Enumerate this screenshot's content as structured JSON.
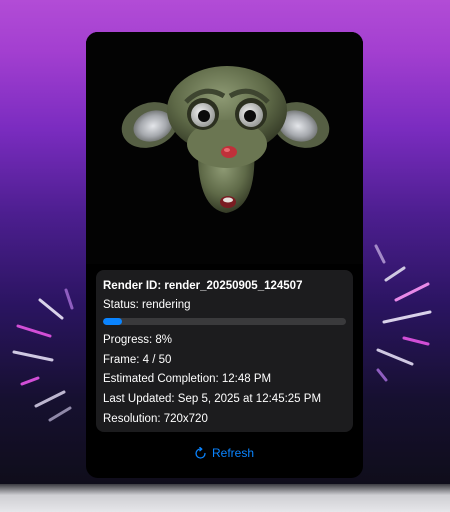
{
  "render": {
    "id_line": "Render ID: render_20250905_124507",
    "status_line": "Status: rendering",
    "progress_fraction": 0.08,
    "progress_line": "Progress: 8%",
    "frame_line": "Frame: 4 / 50",
    "eta_line": "Estimated Completion: 12:48 PM",
    "updated_line": "Last Updated: Sep 5, 2025 at 12:45:25 PM",
    "resolution_line": "Resolution: 720x720"
  },
  "actions": {
    "refresh_label": "Refresh",
    "refresh_icon": "refresh-icon"
  },
  "colors": {
    "accent": "#0a84ff",
    "card_background": "#000000",
    "info_background": "#1c1c1e",
    "progress_track": "#3a3a3c"
  }
}
